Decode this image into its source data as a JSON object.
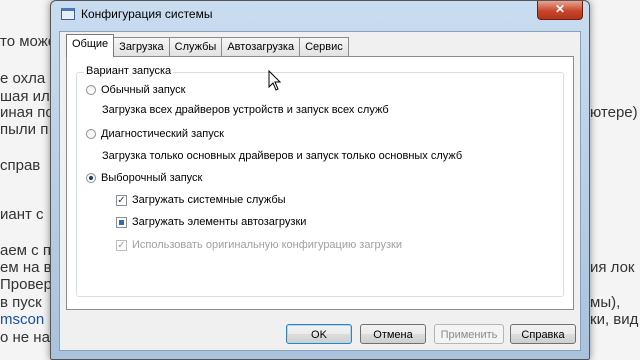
{
  "background": {
    "lines": [
      {
        "text": "то може",
        "side": "left"
      },
      {
        "text": "е охла",
        "side": "left"
      },
      {
        "text": "шая ил",
        "side": "left"
      },
      {
        "text": "иная по",
        "side": "left"
      },
      {
        "text": "пыли п",
        "side": "left"
      },
      {
        "text": "справ",
        "side": "left"
      },
      {
        "text": "иант с",
        "side": "left"
      },
      {
        "text": "аем с п",
        "side": "left"
      },
      {
        "text": "ем на в",
        "side": "left"
      },
      {
        "text": "Провер",
        "side": "left"
      },
      {
        "text": "в пуск",
        "side": "left"
      },
      {
        "text": "mscon",
        "side": "left"
      },
      {
        "text": "о не на",
        "side": "left"
      },
      {
        "text": "ютере)",
        "side": "right"
      },
      {
        "text": "ия лок",
        "side": "right"
      },
      {
        "text": "мы),",
        "side": "right"
      },
      {
        "text": "ки, вид",
        "side": "right"
      }
    ]
  },
  "window": {
    "title": "Конфигурация системы",
    "close_glyph": "✕"
  },
  "tabs": [
    "Общие",
    "Загрузка",
    "Службы",
    "Автозагрузка",
    "Сервис"
  ],
  "group": {
    "legend": "Вариант запуска",
    "normal": {
      "label": "Обычный запуск",
      "desc": "Загрузка всех драйверов устройств и запуск всех служб",
      "selected": false
    },
    "diagnostic": {
      "label": "Диагностический запуск",
      "desc": "Загрузка только основных драйверов и запуск только основных служб",
      "selected": false
    },
    "selective": {
      "label": "Выборочный запуск",
      "selected": true
    },
    "load_services": {
      "label": "Загружать системные службы",
      "checked": true
    },
    "load_startup": {
      "label": "Загружать элементы автозагрузки",
      "state": "indeterminate"
    },
    "use_original": {
      "label": "Использовать оригинальную конфигурацию загрузки",
      "checked": true,
      "disabled": true
    }
  },
  "buttons": {
    "ok": "OK",
    "cancel": "Отмена",
    "apply": "Применить",
    "help": "Справка"
  },
  "icons": {
    "checkmark": "✓"
  }
}
